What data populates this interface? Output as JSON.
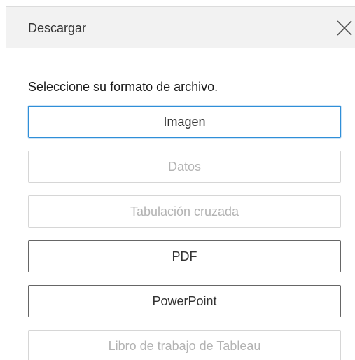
{
  "dialog": {
    "title": "Descargar",
    "close_icon": "close-icon",
    "prompt": "Seleccione su formato de archivo.",
    "formats": [
      {
        "label": "Imagen",
        "state": "focused"
      },
      {
        "label": "Datos",
        "state": "disabled"
      },
      {
        "label": "Tabulación cruzada",
        "state": "disabled"
      },
      {
        "label": "PDF",
        "state": "enabled"
      },
      {
        "label": "PowerPoint",
        "state": "enabled"
      },
      {
        "label": "Libro de trabajo de Tableau",
        "state": "disabled"
      }
    ]
  },
  "colors": {
    "header_bg": "#f2f2f2",
    "focus_border": "#2f8fd8",
    "disabled_text": "#b3b3b3",
    "enabled_border": "#666666"
  }
}
